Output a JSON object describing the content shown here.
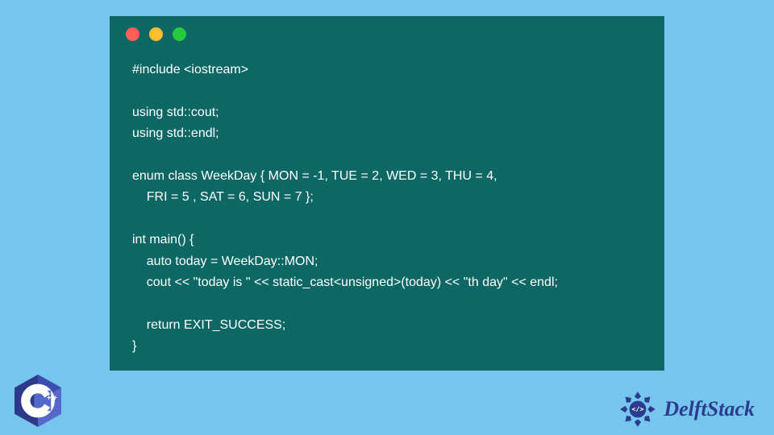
{
  "code": {
    "lines": [
      "#include <iostream>",
      "",
      "using std::cout;",
      "using std::endl;",
      "",
      "enum class WeekDay { MON = -1, TUE = 2, WED = 3, THU = 4,",
      "    FRI = 5 , SAT = 6, SUN = 7 };",
      "",
      "int main() {",
      "    auto today = WeekDay::MON;",
      "    cout << \"today is \" << static_cast<unsigned>(today) << \"th day\" << endl;",
      "",
      "    return EXIT_SUCCESS;",
      "}"
    ]
  },
  "window": {
    "dot_colors": {
      "red": "#ff5f56",
      "yellow": "#ffbd2e",
      "green": "#27c93f"
    }
  },
  "branding": {
    "cpp_label": "C++",
    "site_name": "DelftStack"
  }
}
